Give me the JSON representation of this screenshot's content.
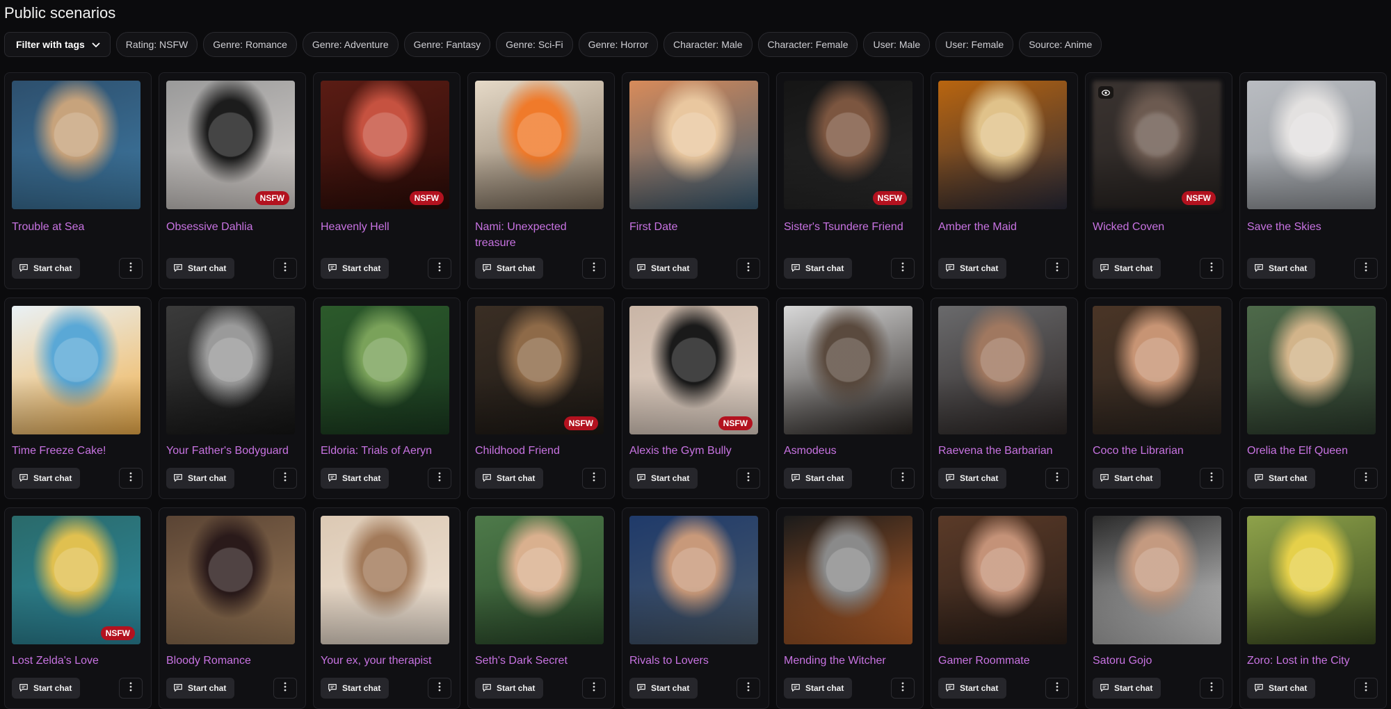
{
  "page_title": "Public scenarios",
  "filter_label": "Filter with tags",
  "tags": [
    "Rating: NSFW",
    "Genre: Romance",
    "Genre: Adventure",
    "Genre: Fantasy",
    "Genre: Sci-Fi",
    "Genre: Horror",
    "Character: Male",
    "Character: Female",
    "User: Male",
    "User: Female",
    "Source: Anime"
  ],
  "start_label": "Start chat",
  "nsfw_label": "NSFW",
  "colors": {
    "accent_title": "#c873e2",
    "nsfw_badge": "#b3121f",
    "background": "#0b0b0d"
  },
  "cards": [
    {
      "title": "Trouble at Sea",
      "nsfw": false,
      "hidden": false,
      "palette": [
        "#2d4f6d",
        "#c7a37c",
        "#3f7aa3"
      ]
    },
    {
      "title": "Obsessive Dahlia",
      "nsfw": true,
      "hidden": false,
      "palette": [
        "#9a9a9a",
        "#1c1c1c",
        "#d9d3cf"
      ]
    },
    {
      "title": "Heavenly Hell",
      "nsfw": true,
      "hidden": false,
      "palette": [
        "#5a1c14",
        "#c65240",
        "#2b0c08"
      ]
    },
    {
      "title": "Nami: Unexpected treasure",
      "nsfw": false,
      "hidden": false,
      "palette": [
        "#e6dac8",
        "#f07a2a",
        "#7a6a58"
      ]
    },
    {
      "title": "First Date",
      "nsfw": false,
      "hidden": false,
      "palette": [
        "#d88b5a",
        "#e9c79f",
        "#385b74"
      ]
    },
    {
      "title": "Sister's Tsundere Friend",
      "nsfw": true,
      "hidden": false,
      "palette": [
        "#151515",
        "#7c5640",
        "#2a2a2a"
      ]
    },
    {
      "title": "Amber the Maid",
      "nsfw": false,
      "hidden": false,
      "palette": [
        "#b9650f",
        "#e0c28a",
        "#2a2a38"
      ]
    },
    {
      "title": "Wicked Coven",
      "nsfw": true,
      "hidden": true,
      "palette": [
        "#3a3330",
        "#6c5a50",
        "#262220"
      ]
    },
    {
      "title": "Save the Skies",
      "nsfw": false,
      "hidden": false,
      "palette": [
        "#b9bcc1",
        "#e3e1e0",
        "#8f9398"
      ]
    },
    {
      "title": "Time Freeze Cake!",
      "nsfw": false,
      "hidden": false,
      "palette": [
        "#e9f1f6",
        "#5aa8d6",
        "#f2b04a"
      ]
    },
    {
      "title": "Your Father's Bodyguard",
      "nsfw": false,
      "hidden": false,
      "palette": [
        "#3b3b3b",
        "#9a9a9a",
        "#151515"
      ]
    },
    {
      "title": "Eldoria: Trials of Aeryn",
      "nsfw": false,
      "hidden": false,
      "palette": [
        "#2c5a2b",
        "#7aa25a",
        "#1a3a20"
      ]
    },
    {
      "title": "Childhood Friend",
      "nsfw": true,
      "hidden": false,
      "palette": [
        "#3a2e24",
        "#8e6a48",
        "#1d1915"
      ]
    },
    {
      "title": "Alexis the Gym Bully",
      "nsfw": true,
      "hidden": false,
      "palette": [
        "#c9b5a6",
        "#1a1a1a",
        "#e6d7cb"
      ]
    },
    {
      "title": "Asmodeus",
      "nsfw": false,
      "hidden": false,
      "palette": [
        "#d8d8d8",
        "#5a4a3e",
        "#2a2522"
      ]
    },
    {
      "title": "Raevena the Barbarian",
      "nsfw": false,
      "hidden": false,
      "palette": [
        "#6a6a6c",
        "#a07860",
        "#2c2625"
      ]
    },
    {
      "title": "Coco the Librarian",
      "nsfw": false,
      "hidden": false,
      "palette": [
        "#4a3526",
        "#c79474",
        "#2b241f"
      ]
    },
    {
      "title": "Orelia the Elf Queen",
      "nsfw": false,
      "hidden": false,
      "palette": [
        "#4e6a4a",
        "#d2b48a",
        "#2b3a2c"
      ]
    },
    {
      "title": "Lost Zelda's Love",
      "nsfw": true,
      "hidden": false,
      "palette": [
        "#2a6a6a",
        "#e0c050",
        "#2d8aa0"
      ]
    },
    {
      "title": "Bloody Romance",
      "nsfw": false,
      "hidden": false,
      "palette": [
        "#5a4434",
        "#2a1a1a",
        "#9b7a58"
      ]
    },
    {
      "title": "Your ex, your therapist",
      "nsfw": false,
      "hidden": false,
      "palette": [
        "#dcc9b4",
        "#a27a5a",
        "#efe3d6"
      ]
    },
    {
      "title": "Seth's Dark Secret",
      "nsfw": false,
      "hidden": false,
      "palette": [
        "#4e7a4a",
        "#d9b08e",
        "#2a4a2a"
      ]
    },
    {
      "title": "Rivals to Lovers",
      "nsfw": false,
      "hidden": false,
      "palette": [
        "#1f3a6a",
        "#c8997a",
        "#4a5a6a"
      ]
    },
    {
      "title": "Mending the Witcher",
      "nsfw": false,
      "hidden": false,
      "palette": [
        "#1a1a1a",
        "#8a8a8a",
        "#c0642a"
      ]
    },
    {
      "title": "Gamer Roommate",
      "nsfw": false,
      "hidden": false,
      "palette": [
        "#5a3a28",
        "#c49278",
        "#2a1e18"
      ]
    },
    {
      "title": "Satoru Gojo",
      "nsfw": false,
      "hidden": false,
      "palette": [
        "#2a2a2a",
        "#c49a80",
        "#d8d8d8"
      ]
    },
    {
      "title": "Zoro: Lost in the City",
      "nsfw": false,
      "hidden": false,
      "palette": [
        "#8ea24a",
        "#e5d04a",
        "#3a4a20"
      ]
    }
  ]
}
